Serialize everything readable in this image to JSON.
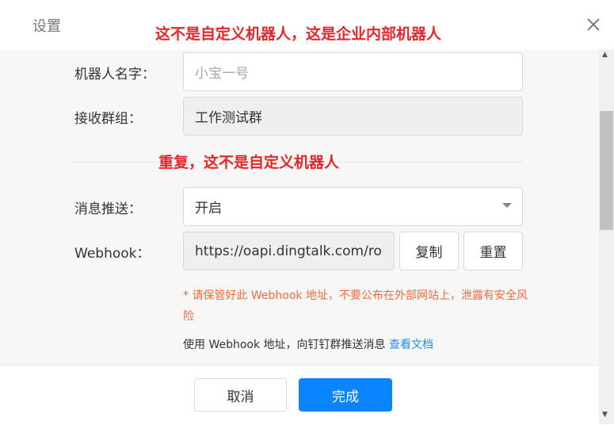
{
  "dialog": {
    "title": "设置",
    "close_icon": "close-icon"
  },
  "annotations": {
    "top": "这不是自定义机器人，这是企业内部机器人",
    "middle": "重复，这不是自定义机器人"
  },
  "form": {
    "robot_name": {
      "label": "机器人名字：",
      "placeholder": "小宝一号"
    },
    "receive_group": {
      "label": "接收群组：",
      "value": "工作测试群"
    },
    "message_push": {
      "label": "消息推送：",
      "value": "开启",
      "dropdown_icon": "caret-down-icon"
    },
    "webhook": {
      "label": "Webhook：",
      "value": "https://oapi.dingtalk.com/ro",
      "copy_label": "复制",
      "reset_label": "重置"
    },
    "warning": "* 请保管好此 Webhook 地址，不要公布在外部网站上，泄露有安全风险",
    "usage_text": "使用 Webhook 地址，向钉钉群推送消息",
    "usage_link": "查看文档"
  },
  "footer": {
    "cancel_label": "取消",
    "ok_label": "完成"
  },
  "colors": {
    "annotation": "#e5262b",
    "warning": "#f06a3b",
    "link": "#1a8cff",
    "primary": "#0a84ff"
  }
}
